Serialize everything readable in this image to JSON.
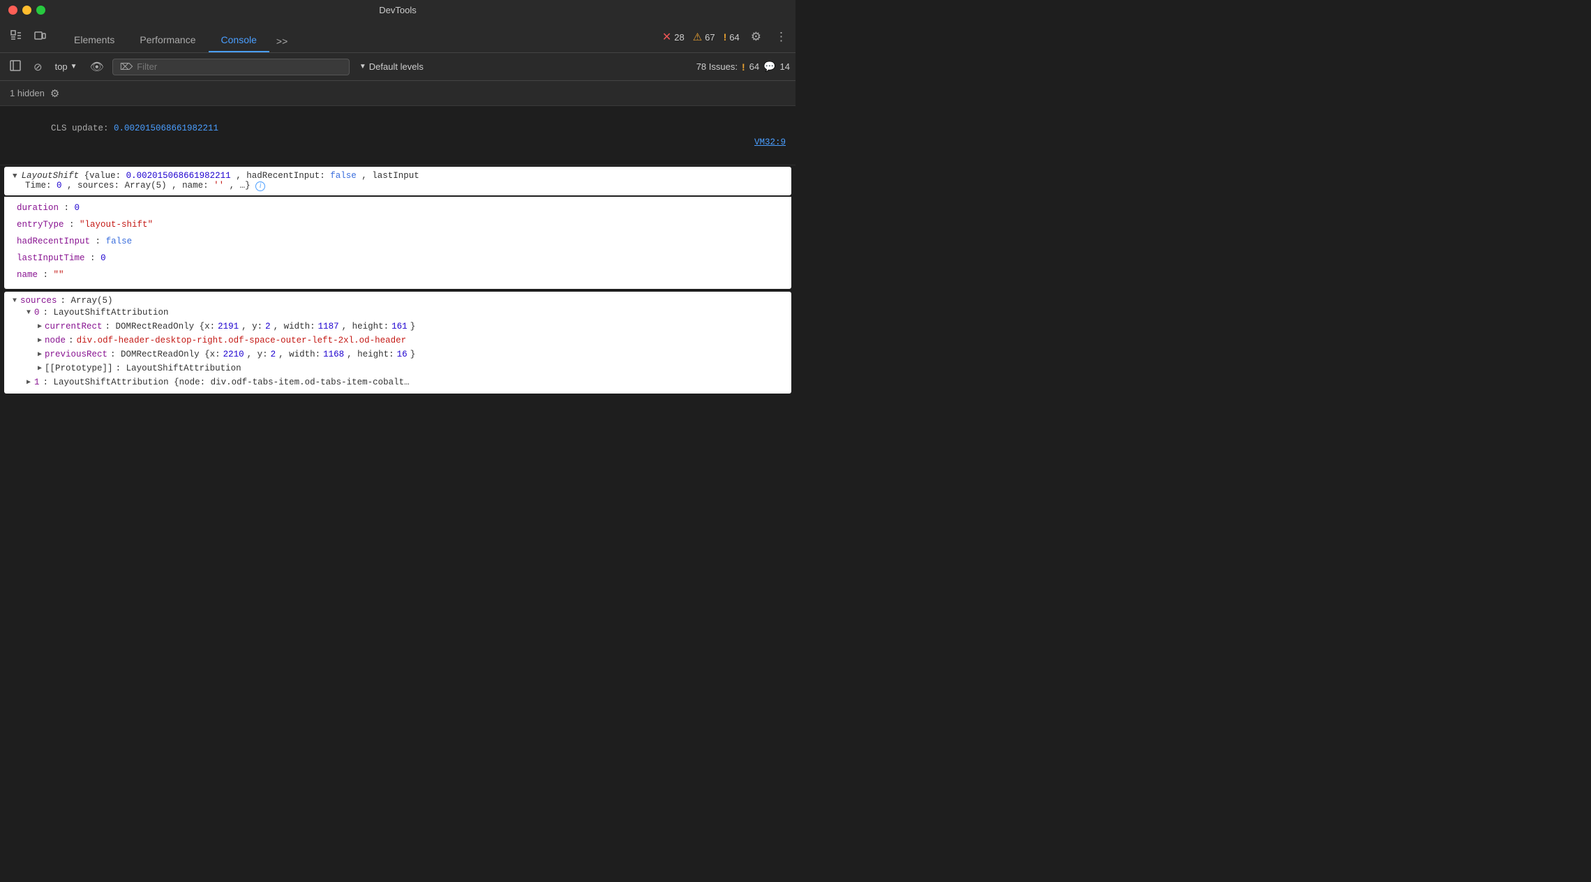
{
  "titleBar": {
    "title": "DevTools"
  },
  "tabs": {
    "items": [
      {
        "label": "Elements",
        "active": false
      },
      {
        "label": "Performance",
        "active": false
      },
      {
        "label": "Console",
        "active": true
      }
    ],
    "more": ">>"
  },
  "badges": {
    "errors": {
      "icon": "✕",
      "count": "28"
    },
    "warnings": {
      "icon": "⚠",
      "count": "67"
    },
    "info": {
      "icon": "!",
      "count": "64"
    }
  },
  "consoleToolbar": {
    "context": "top",
    "filterPlaceholder": "Filter",
    "levelsLabel": "Default levels",
    "issuesLabel": "78 Issues:",
    "issuesWarning": "64",
    "issuesChat": "14"
  },
  "hiddenBar": {
    "text": "1 hidden"
  },
  "consoleLines": {
    "clsLine": "CLS update: 0.002015068661982211",
    "clsFile": "VM32:9",
    "objectHeader": "LayoutShift {value: 0.002015068661982211, hadRecentInput: false, lastInputTime: 0, sources: Array(5), name: '', …}",
    "props": [
      {
        "key": "duration",
        "value": "0",
        "type": "num"
      },
      {
        "key": "entryType",
        "value": "\"layout-shift\"",
        "type": "str"
      },
      {
        "key": "hadRecentInput",
        "value": "false",
        "type": "blue"
      },
      {
        "key": "lastInputTime",
        "value": "0",
        "type": "num"
      },
      {
        "key": "name",
        "value": "\"\"",
        "type": "str"
      }
    ],
    "sourcesHeader": "sources: Array(5)",
    "item0Label": "0: LayoutShiftAttribution",
    "item0Props": [
      {
        "key": "currentRect",
        "value": "DOMRectReadOnly {x: 2191, y: 2, width: 1187, height: 161}",
        "highlights": {
          "x": "2191",
          "width": "1187",
          "height": "161"
        }
      },
      {
        "key": "node",
        "value": "div.odf-header-desktop-right.odf-space-outer-left-2xl.od-header"
      },
      {
        "key": "previousRect",
        "value": "DOMRectReadOnly {x: 2210, y: 2, width: 1168, height: 16}",
        "highlights": {
          "x": "2210",
          "width": "1168",
          "height": "16"
        }
      },
      {
        "key": "[[Prototype]]",
        "value": "LayoutShiftAttribution"
      }
    ],
    "item1Label": "1: LayoutShiftAttribution {node: div.odf-tabs-item.od-tabs-item-cobalt…"
  }
}
